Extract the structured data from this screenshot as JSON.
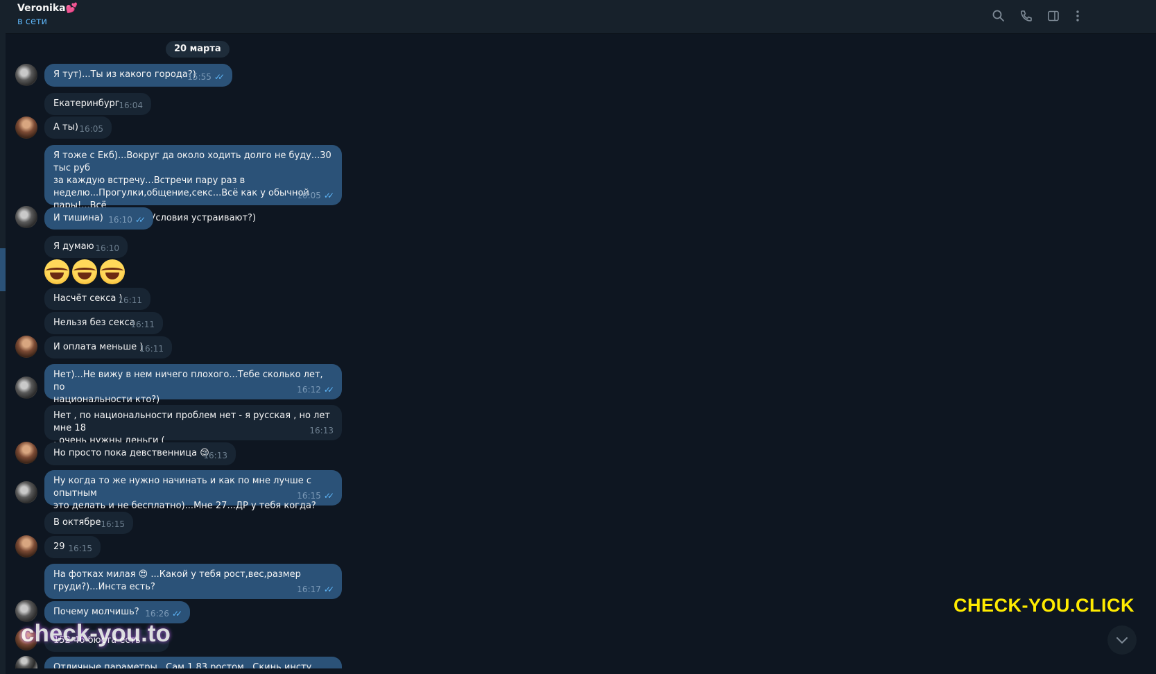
{
  "header": {
    "name": "Veronika💕",
    "status": "в сети",
    "icons": [
      "search-icon",
      "phone-icon",
      "sidebar-toggle-icon",
      "more-vertical-icon"
    ]
  },
  "date_separator": "20 марта",
  "messages": [
    {
      "dir": "out",
      "text": "Я тут)...Ты из какого города?)",
      "time": "15:55",
      "read": true
    },
    {
      "dir": "in",
      "text": "Екатеринбург",
      "time": "16:04"
    },
    {
      "dir": "in",
      "text": "А ты)",
      "time": "16:05"
    },
    {
      "dir": "out",
      "text": "Я тоже с Екб)...Вокруг да около ходить долго не буду...30 тыс руб\nза каждую встречу...Встречи пару раз в\nнеделю...Прогулки,общение,секс...Всё как у обычной пары!...Всё\nконфиденциально...Условия устраивают?)",
      "time": "16:05",
      "read": true
    },
    {
      "dir": "out",
      "text": "И тишина)",
      "time": "16:10",
      "read": true
    },
    {
      "dir": "in",
      "text": "Я думаю",
      "time": "16:10"
    },
    {
      "dir": "in",
      "emoji": "😂😂😂"
    },
    {
      "dir": "in",
      "text": "Насчёт секса )",
      "time": "16:11"
    },
    {
      "dir": "in",
      "text": "Нельзя без секса",
      "time": "16:11"
    },
    {
      "dir": "in",
      "text": "И оплата меньше )",
      "time": "16:11"
    },
    {
      "dir": "out",
      "text": "Нет)...Не вижу в нем ничего плохого...Тебе сколько лет, по\nнациональности кто?)",
      "time": "16:12",
      "read": true
    },
    {
      "dir": "in",
      "text": "Нет , по национальности проблем нет - я русская , но лет мне 18\n, очень нужны деньги (",
      "time": "16:13"
    },
    {
      "dir": "in",
      "text": "Но просто пока девственница 😌",
      "time": "16:13"
    },
    {
      "dir": "out",
      "text": "Ну когда то же нужно начинать и как по мне лучше с опытным\nэто делать и не бесплатно)...Мне 27...ДР у тебя когда?",
      "time": "16:15",
      "read": true
    },
    {
      "dir": "in",
      "text": "В октябре",
      "time": "16:15"
    },
    {
      "dir": "in",
      "text": "29",
      "time": "16:15"
    },
    {
      "dir": "out",
      "text": "На фотках милая 😍 ...Какой у тебя рост,вес,размер\nгруди?)...Инста есть?",
      "time": "16:17",
      "read": true
    },
    {
      "dir": "out",
      "text": "Почему молчишь?",
      "time": "16:26",
      "read": true
    },
    {
      "dir": "in",
      "text": "152 46 бюста есть",
      "time": ""
    },
    {
      "dir": "out",
      "text": "Отличные параметры...Сам 1.83 ростом...Скинь инсту",
      "time": ""
    }
  ],
  "watermarks": {
    "top_right": "CHECK-YOU.CLICK",
    "bottom_left": "check-you.to"
  }
}
